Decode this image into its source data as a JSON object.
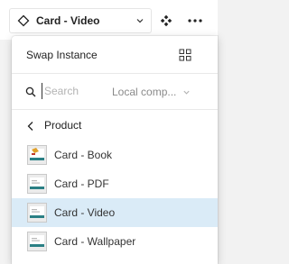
{
  "toolbar": {
    "instance_name": "Card - Video",
    "instance_icon": "instance-diamond-icon",
    "dropdown_icon": "chevron-down-icon",
    "component_icon": "component-icon",
    "more_icon": "more-horizontal-icon"
  },
  "panel": {
    "title": "Swap Instance",
    "view_toggle_icon": "grid-view-icon",
    "search": {
      "placeholder": "Search",
      "value": "",
      "library": "Local comp..."
    },
    "breadcrumb": {
      "label": "Product",
      "icon": "chevron-left-icon"
    },
    "items": [
      {
        "label": "Card - Book",
        "thumbnail": "book-thumbnail",
        "selected": false
      },
      {
        "label": "Card - PDF",
        "thumbnail": "pdf-thumbnail",
        "selected": false
      },
      {
        "label": "Card - Video",
        "thumbnail": "video-thumbnail",
        "selected": true
      },
      {
        "label": "Card - Wallpaper",
        "thumbnail": "wallpaper-thumbnail",
        "selected": false
      }
    ]
  },
  "colors": {
    "selected_row": "#daebf7",
    "thumbnail_accent": "#2a7f84",
    "book_accent": "#e0a02a"
  }
}
